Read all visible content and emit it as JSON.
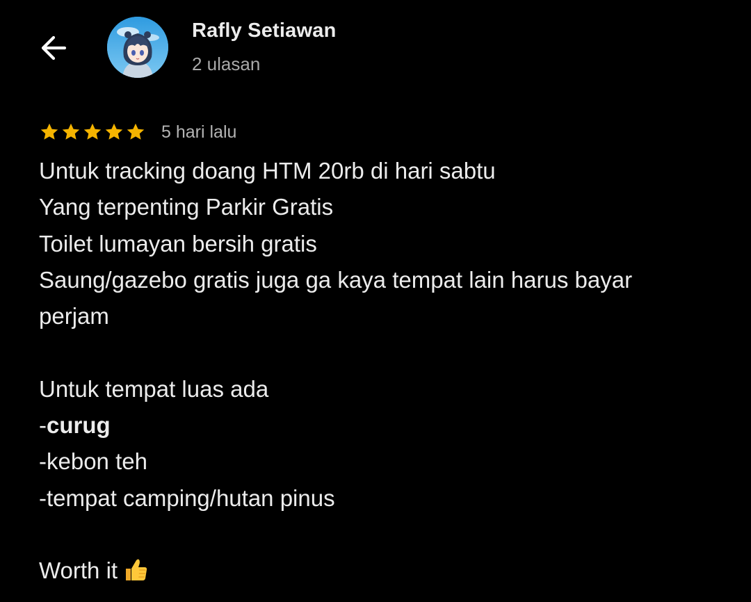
{
  "header": {
    "back_icon": "arrow-left-icon",
    "author_name": "Rafly Setiawan",
    "review_count": "2 ulasan"
  },
  "review": {
    "rating": 5,
    "max_rating": 5,
    "star_color": "#f5b400",
    "date": "5 hari lalu",
    "lines": [
      "Untuk tracking doang HTM 20rb di hari sabtu",
      "Yang terpenting Parkir Gratis",
      "Toilet lumayan bersih gratis",
      "Saung/gazebo gratis juga ga kaya tempat lain harus bayar",
      "perjam"
    ],
    "list_intro": "Untuk tempat luas ada",
    "list_item_1_prefix": "-",
    "list_item_1_bold": "curug",
    "list_item_2": "-kebon teh",
    "list_item_3": "-tempat camping/hutan pinus",
    "closing": "Worth it",
    "closing_emoji": "thumbs-up-icon"
  },
  "colors": {
    "background": "#000000",
    "text": "#ececec",
    "secondary_text": "#a8a8a8"
  }
}
